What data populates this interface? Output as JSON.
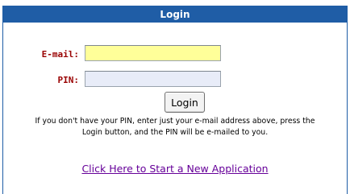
{
  "panel": {
    "title": "Login"
  },
  "form": {
    "email_label": "E-mail:",
    "email_value": "",
    "pin_label": "PIN:",
    "pin_value": "",
    "login_button": "Login"
  },
  "info": {
    "line1": "If you don't have your PIN, enter just your e-mail address above, press the",
    "line2": "Login button, and the PIN will be e-mailed to you."
  },
  "links": {
    "new_application": "Click Here to Start a New Application"
  },
  "colors": {
    "header_bg": "#1f5da6",
    "label_text": "#990000",
    "email_field_bg": "#ffff99",
    "pin_field_bg": "#e8ecf8",
    "visited_link": "#660099"
  }
}
